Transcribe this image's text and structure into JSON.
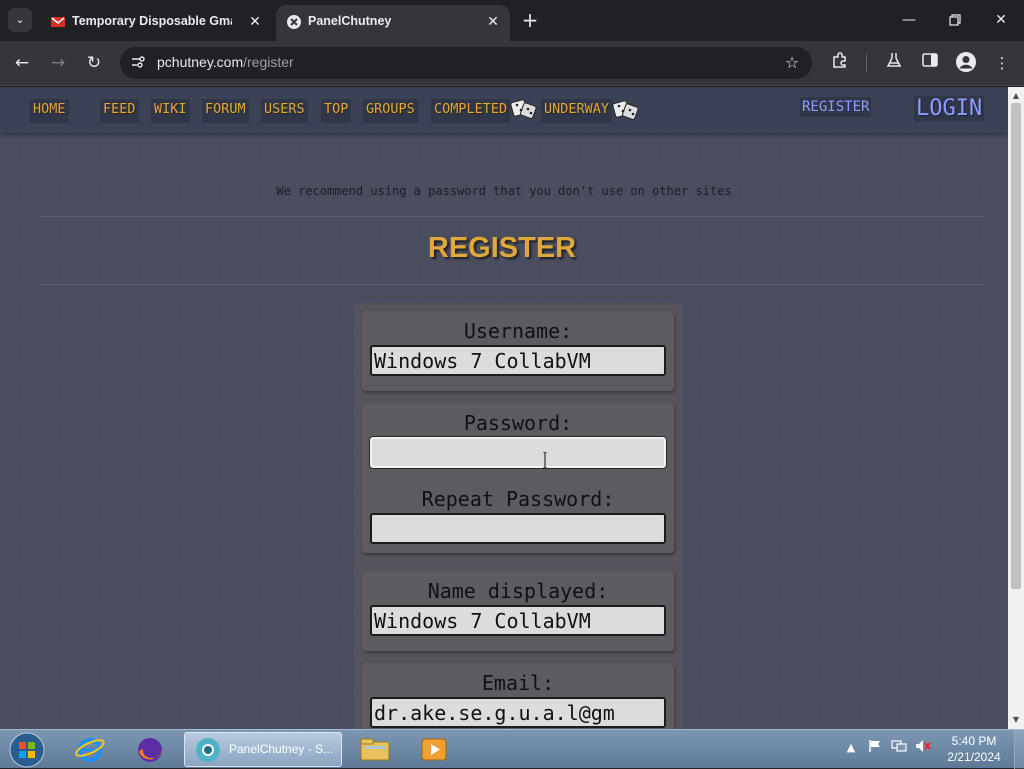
{
  "browser": {
    "tabs": [
      {
        "title": "Temporary Disposable Gmail |",
        "active": false,
        "icon": "gmail-favicon"
      },
      {
        "title": "PanelChutney",
        "active": true,
        "icon": "panelchutney-favicon"
      }
    ],
    "address": {
      "host": "pchutney.com",
      "path": "/register"
    },
    "colors": {
      "frame": "#202124",
      "toolbar": "#35363a"
    }
  },
  "site": {
    "nav": {
      "items": [
        "HOME",
        "FEED",
        "WIKI",
        "FORUM",
        "USERS",
        "TOP",
        "GROUPS",
        "COMPLETED",
        "UNDERWAY"
      ],
      "register": "REGISTER",
      "login": "LOGIN"
    },
    "notice": "We recommend using a password that you don't use on other sites",
    "heading": "REGISTER",
    "form": {
      "username_label": "Username:",
      "username_value": "Windows 7 CollabVM",
      "password_label": "Password:",
      "password_value": "",
      "repeat_password_label": "Repeat Password:",
      "repeat_password_value": "",
      "display_name_label": "Name displayed:",
      "display_name_value": "Windows 7 CollabVM",
      "email_label": "Email:",
      "email_value": "dr.ake.se.g.u.a.l@gm"
    },
    "colors": {
      "accent": "#e0a83a",
      "link_blue": "#8c9cff",
      "background": "#4a4d5e"
    }
  },
  "taskbar": {
    "active_app_label": "PanelChutney - S...",
    "clock_time": "5:40 PM",
    "clock_date": "2/21/2024",
    "pinned": [
      "internet-explorer-icon",
      "firefox-icon",
      "chromium-icon",
      "file-explorer-icon",
      "media-player-icon"
    ]
  }
}
